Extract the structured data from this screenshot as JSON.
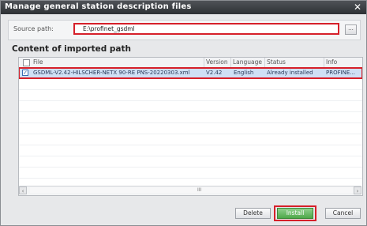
{
  "window": {
    "title": "Manage general station description files",
    "close_icon": "close-icon"
  },
  "source": {
    "label": "Source path:",
    "value": "E:\\profinet_gsdml",
    "browse_label": "..."
  },
  "content": {
    "title": "Content of imported path"
  },
  "table": {
    "headers": [
      "File",
      "Version",
      "Language",
      "Status",
      "Info"
    ],
    "rows": [
      {
        "checked": true,
        "file": "GSDML-V2.42-HILSCHER-NETX 90-RE PNS-20220303.xml",
        "version": "V2.42",
        "language": "English",
        "status": "Already installed",
        "info": "PROFINE..."
      }
    ]
  },
  "scrollbar": {
    "left_arrow": "‹",
    "right_arrow": "›",
    "grip": "III"
  },
  "buttons": {
    "delete": "Delete",
    "install": "Install",
    "cancel": "Cancel"
  },
  "colors": {
    "highlight_red": "#d6202a",
    "selected_row": "#cfe0f5",
    "install_green": "#4ea84a",
    "titlebar": "#3a3d42"
  }
}
